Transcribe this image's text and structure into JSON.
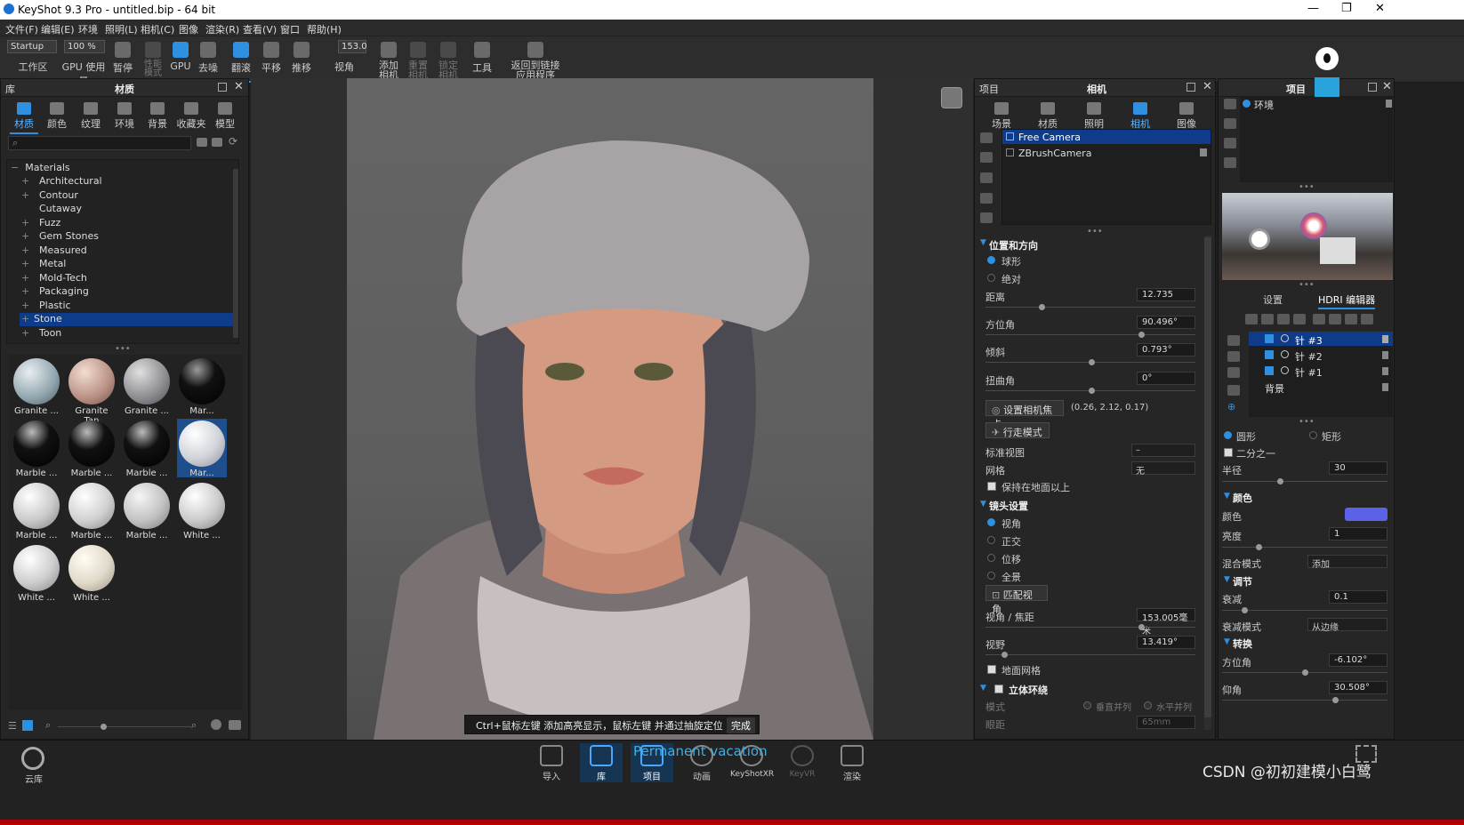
{
  "window": {
    "title": "KeyShot 9.3 Pro - untitled.bip - 64 bit"
  },
  "menu": [
    "文件(F)",
    "编辑(E)",
    "环境",
    "照明(L)",
    "相机(C)",
    "图像",
    "渲染(R)",
    "查看(V)",
    "窗口",
    "帮助(H)"
  ],
  "toolbar": {
    "preset_select": "Startup",
    "zoom_value": "100 %",
    "fov_value": "153.0",
    "items": [
      "工作区",
      "GPU 使用量",
      "暂停",
      "性能模式",
      "GPU",
      "去噪",
      "翻滚",
      "平移",
      "推移",
      "视角",
      "添加相机",
      "重置相机",
      "锁定相机",
      "工具",
      "返回到链接应用程序"
    ]
  },
  "library": {
    "header_left": "库",
    "title": "材质",
    "tabs": [
      "材质",
      "颜色",
      "纹理",
      "环境",
      "背景",
      "收藏夹",
      "模型"
    ],
    "tree_root": "Materials",
    "tree_items": [
      "Architectural",
      "Contour",
      "Cutaway",
      "Fuzz",
      "Gem Stones",
      "Measured",
      "Metal",
      "Mold-Tech",
      "Packaging",
      "Plastic",
      "Stone",
      "Toon"
    ],
    "thumbs": [
      "Granite ...",
      "Granite Tan",
      "Granite ...",
      "Mar...",
      "Marble ...",
      "Marble ...",
      "Marble ...",
      "Mar...",
      "Marble ...",
      "Marble ...",
      "Marble ...",
      "White ...",
      "White ...",
      "White ..."
    ]
  },
  "viewport": {
    "hint_text": "Ctrl+鼠标左键 添加高亮显示，鼠标左键 并通过抽旋定位",
    "done_button": "完成"
  },
  "camera_panel": {
    "header_left": "项目",
    "title": "相机",
    "tabs": [
      "场景",
      "材质",
      "照明",
      "相机",
      "图像"
    ],
    "cameras": [
      "Free Camera",
      "ZBrushCamera"
    ],
    "section_position": "位置和方向",
    "radio_spherical": "球形",
    "radio_absolute": "绝对",
    "distance_label": "距离",
    "distance_value": "12.735",
    "azimuth_label": "方位角",
    "azimuth_value": "90.496°",
    "incline_label": "倾斜",
    "incline_value": "0.793°",
    "twist_label": "扭曲角",
    "twist_value": "0°",
    "set_focus_button": "设置相机焦点",
    "focus_coords": "(0.26, 2.12, 0.17)",
    "walk_mode_button": "行走模式",
    "std_view_label": "标准视图",
    "std_view_value": "–",
    "grid_label": "网格",
    "grid_value": "无",
    "keep_above_ground": "保持在地面以上",
    "section_lens": "镜头设置",
    "lens_perspective": "视角",
    "lens_ortho": "正交",
    "lens_shift": "位移",
    "lens_panorama": "全景",
    "match_persp_button": "匹配视角",
    "focal_label": "视角 / 焦距",
    "focal_value": "153.005毫米",
    "fov_label": "视野",
    "fov_value": "13.419°",
    "ground_grid": "地面网格",
    "section_stereo": "立体环绕",
    "stereo_mode_label": "模式",
    "stereo_vertical": "垂直并列",
    "stereo_horizontal": "水平并列",
    "eye_distance_label": "眼距",
    "eye_distance_value": "65mm"
  },
  "env_panel": {
    "header_title": "项目",
    "env_item": "环境",
    "tab_settings": "设置",
    "tab_hdri": "HDRI 编辑器",
    "pins": [
      "针 #3",
      "针 #2",
      "针 #1"
    ],
    "background_row": "背景",
    "shape_circle": "圆形",
    "shape_rect": "矩形",
    "half": "二分之一",
    "radius_label": "半径",
    "radius_value": "30",
    "section_color": "颜色",
    "color_label": "颜色",
    "color_value": "#5b62e8",
    "brightness_label": "亮度",
    "brightness_value": "1",
    "blend_label": "混合模式",
    "blend_value": "添加",
    "section_adjust": "调节",
    "falloff_label": "衰减",
    "falloff_value": "0.1",
    "falloff_mode_label": "衰减模式",
    "falloff_mode_value": "从边缘",
    "section_transform": "转换",
    "azimuth_label": "方位角",
    "azimuth_value": "-6.102°",
    "elevation_label": "仰角",
    "elevation_value": "30.508°"
  },
  "bottom": {
    "cloud_label": "云库",
    "buttons": [
      "导入",
      "库",
      "项目",
      "动画",
      "KeyShotXR",
      "KeyVR",
      "渲染"
    ],
    "overlay_text": "Permanent vacation",
    "watermark": "CSDN @初初建模小白鹭"
  }
}
